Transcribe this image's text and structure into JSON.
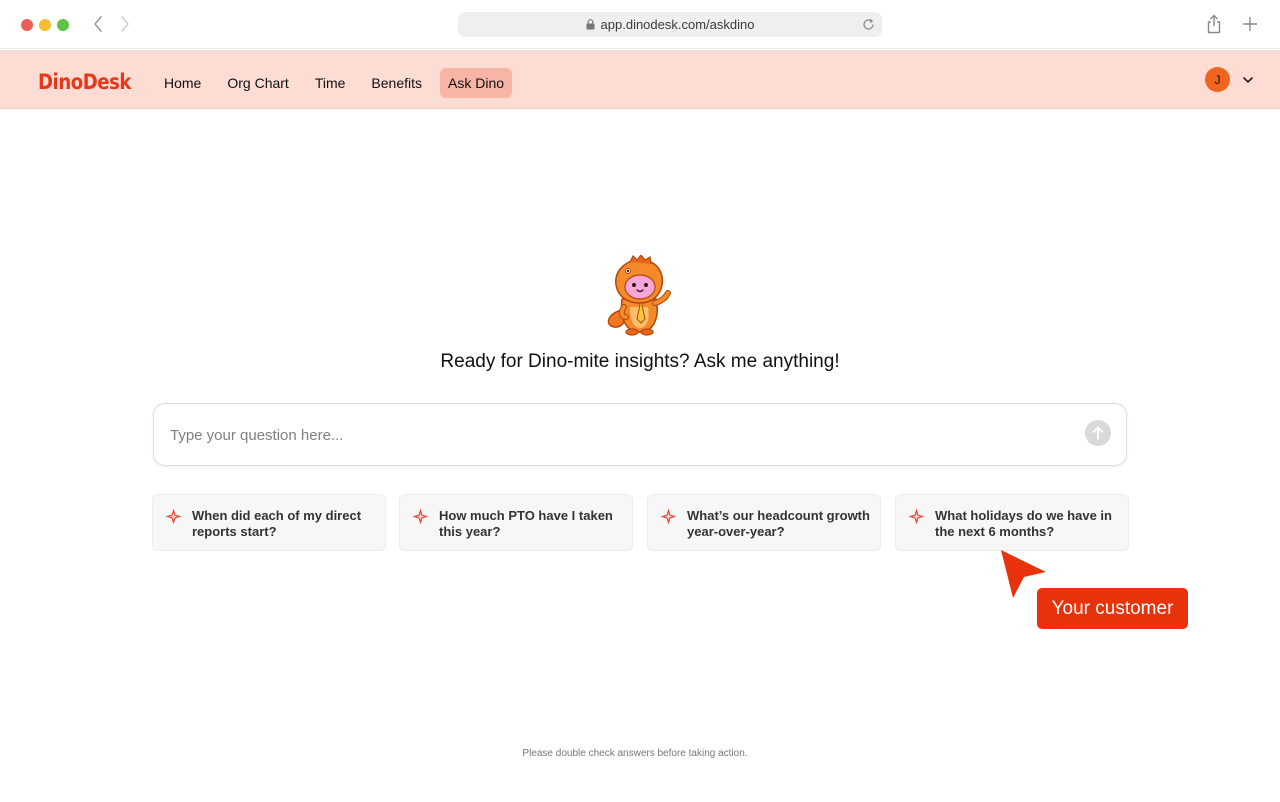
{
  "browser": {
    "url": "app.dinodesk.com/askdino",
    "icons": [
      "back-icon",
      "forward-icon",
      "lock-icon",
      "reload-icon",
      "share-icon",
      "new-tab-icon"
    ]
  },
  "header": {
    "logo": "DinoDesk",
    "nav": [
      {
        "label": "Home",
        "active": false
      },
      {
        "label": "Org Chart",
        "active": false
      },
      {
        "label": "Time",
        "active": false
      },
      {
        "label": "Benefits",
        "active": false
      },
      {
        "label": "Ask Dino",
        "active": true
      }
    ],
    "avatar_initial": "J",
    "colors": {
      "bar": "#fddcd4",
      "brand": "#e8381a",
      "active_tab": "#f8b4a5",
      "avatar": "#f0641e"
    }
  },
  "main": {
    "headline": "Ready for Dino-mite insights? Ask me anything!",
    "input_placeholder": "Type your question here...",
    "suggestions": [
      {
        "text": "When did each of my direct reports start?"
      },
      {
        "text": "How much PTO have I taken this year?"
      },
      {
        "text": "What’s our headcount growth year-over-year?"
      },
      {
        "text": "What holidays do we have in the next 6 months?"
      }
    ],
    "footer": "Please double check answers before taking action."
  },
  "annotation": {
    "label": "Your customer",
    "color": "#e8320c"
  }
}
